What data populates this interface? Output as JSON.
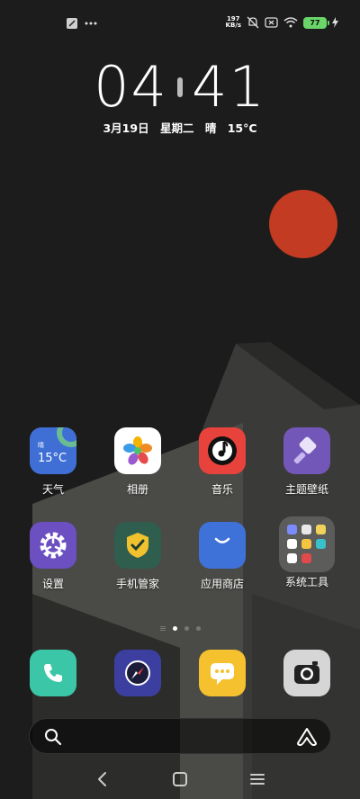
{
  "status_bar": {
    "left_icons": [
      "wrench-icon",
      "more-dots-icon"
    ],
    "net_speed_value": "197",
    "net_speed_unit": "KB/s",
    "right_icons": [
      "mute-bell-icon",
      "sim-x-icon",
      "wifi-icon",
      "charging-icon"
    ],
    "battery": "77"
  },
  "clock": {
    "hours": "04",
    "minutes": "41"
  },
  "date": {
    "date": "3月19日",
    "weekday": "星期二",
    "weather": "晴",
    "temp": "15°C"
  },
  "apps_row1": [
    {
      "label": "天气",
      "icon": "weather-icon",
      "icon_text": "晴",
      "icon_temp": "15°C"
    },
    {
      "label": "相册",
      "icon": "gallery-icon"
    },
    {
      "label": "音乐",
      "icon": "music-icon"
    },
    {
      "label": "主题壁纸",
      "icon": "theme-brush-icon"
    }
  ],
  "apps_row2": [
    {
      "label": "设置",
      "icon": "settings-gear-icon"
    },
    {
      "label": "手机管家",
      "icon": "security-shield-icon"
    },
    {
      "label": "应用商店",
      "icon": "app-store-bag-icon"
    },
    {
      "label": "系统工具",
      "icon": "system-tools-folder-icon"
    }
  ],
  "dock": [
    {
      "name": "phone",
      "icon": "phone-icon",
      "color": "#3cc6a8"
    },
    {
      "name": "browser",
      "icon": "compass-icon",
      "color": "#3c3fa0"
    },
    {
      "name": "messages",
      "icon": "message-icon",
      "color": "#f5c12e"
    },
    {
      "name": "camera",
      "icon": "camera-icon",
      "color": "#d6d6d6"
    }
  ],
  "page_indicator": {
    "pages": 3,
    "active": 0
  },
  "search_bar": {
    "left_icon": "search-icon",
    "right_icon": "assistant-icon"
  },
  "nav_bar": [
    "back-icon",
    "home-icon",
    "recents-menu-icon"
  ],
  "colors": {
    "sun": "#c23b22",
    "background": "#1b1b1b",
    "battery": "#6ad66a"
  }
}
